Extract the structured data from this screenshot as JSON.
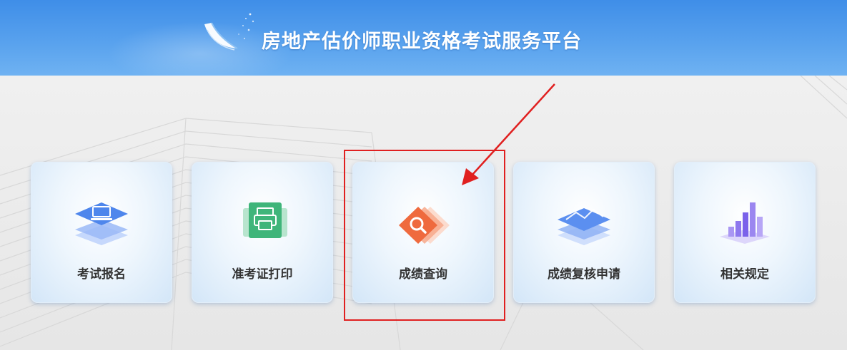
{
  "header": {
    "title": "房地产估价师职业资格考试服务平台"
  },
  "cards": [
    {
      "label": "考试报名",
      "icon": "computer-icon"
    },
    {
      "label": "准考证打印",
      "icon": "printer-icon"
    },
    {
      "label": "成绩查询",
      "icon": "search-icon"
    },
    {
      "label": "成绩复核申请",
      "icon": "layers-chart-icon"
    },
    {
      "label": "相关规定",
      "icon": "bar-chart-icon"
    }
  ],
  "colors": {
    "header_blue": "#4a97ea",
    "annotation_red": "#e02020",
    "card_text": "#333333"
  }
}
